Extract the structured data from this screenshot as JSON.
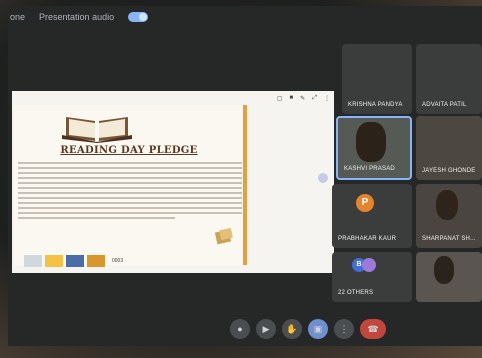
{
  "topbar": {
    "left_fragment": "one",
    "presentation_audio_label": "Presentation audio",
    "presentation_audio_on": true
  },
  "slide": {
    "title": "READING DAY PLEDGE",
    "toolbar_icons": [
      "square-icon",
      "dot-icon",
      "pin-icon",
      "expand-icon",
      "more-icon"
    ],
    "thumbs_label": "0003"
  },
  "participants": [
    {
      "name": "Krishna Pandya"
    },
    {
      "name": "Advaita Patil"
    },
    {
      "name": "Kashvi Prasad",
      "selected": true
    },
    {
      "name": "Jayesh Ghonde"
    },
    {
      "name": "Prabhakar Kaur",
      "initial": "P",
      "avatar_color": "#e5842a"
    },
    {
      "name": "Sharpanat Sh..."
    },
    {
      "name": "22 others",
      "initial": "B",
      "avatar_color": "#3d6fd6"
    },
    {
      "name": ""
    }
  ],
  "colors": {
    "accent_blue": "#8ab4f8",
    "end_call": "#c2463b"
  }
}
